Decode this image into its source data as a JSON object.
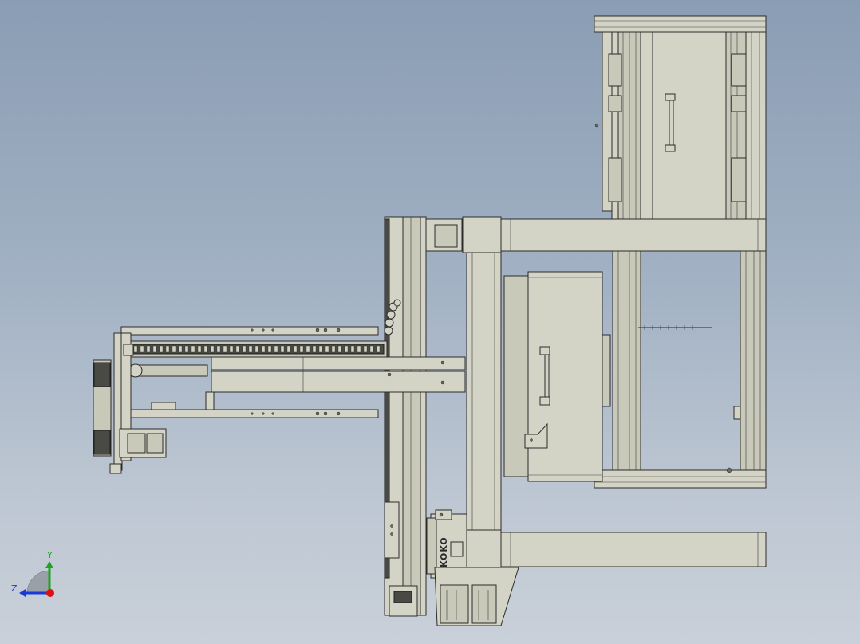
{
  "viewport": {
    "background_top": "#8a9db4",
    "background_bottom": "#c9d0d9"
  },
  "model": {
    "part_color": "#d4d4c6",
    "edge_color": "#2b2b2b",
    "logo_text": "KOKO"
  },
  "triad": {
    "y_label": "Y",
    "z_label": "Z",
    "y_color": "#1aa51a",
    "z_color": "#1a3ad6",
    "origin_color": "#e01010"
  }
}
